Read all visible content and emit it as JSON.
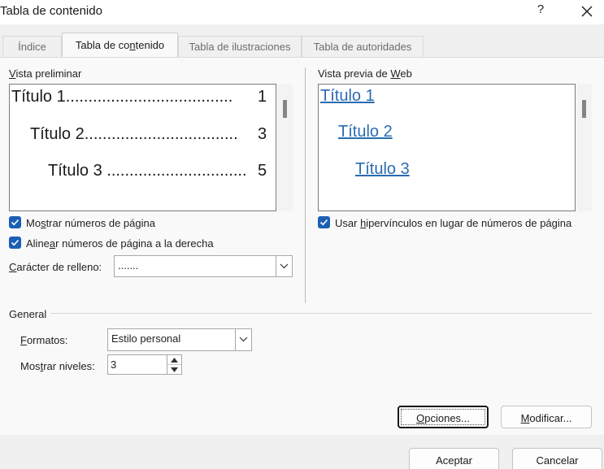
{
  "window": {
    "title": "Tabla de contenido",
    "help_label": "?",
    "close_icon": "close-icon"
  },
  "tabs": [
    {
      "label": "Índice",
      "active": false
    },
    {
      "label": "Tabla de contenido",
      "active": true
    },
    {
      "label": "Tabla de ilustraciones",
      "active": false
    },
    {
      "label": "Tabla de autoridades",
      "active": false
    }
  ],
  "print_preview": {
    "label": "Vista preliminar",
    "entries": [
      {
        "text": "Título 1.....................................",
        "page": "1"
      },
      {
        "text": "Título 2..................................",
        "page": "3"
      },
      {
        "text": "Título 3 ...............................",
        "page": "5"
      }
    ]
  },
  "web_preview": {
    "label": "Vista previa de Web",
    "entries": [
      "Título 1",
      "Título 2",
      "Título 3"
    ]
  },
  "options": {
    "show_page_numbers": {
      "label": "Mostrar números de página",
      "checked": true
    },
    "right_align": {
      "label": "Alinear números de página a la derecha",
      "checked": true
    },
    "use_hyperlinks": {
      "label": "Usar hipervínculos en lugar de números de página",
      "checked": true
    },
    "tab_leader": {
      "label": "Carácter de relleno:",
      "value": "......."
    }
  },
  "general": {
    "label": "General",
    "formats_label": "Formatos:",
    "formats_value": "Estilo personal",
    "levels_label": "Mostrar niveles:",
    "levels_value": "3"
  },
  "buttons": {
    "options": "Opciones...",
    "modify": "Modificar...",
    "ok": "Aceptar",
    "cancel": "Cancelar"
  },
  "colors": {
    "accent": "#1a5fb4",
    "link": "#2b6cb0"
  }
}
